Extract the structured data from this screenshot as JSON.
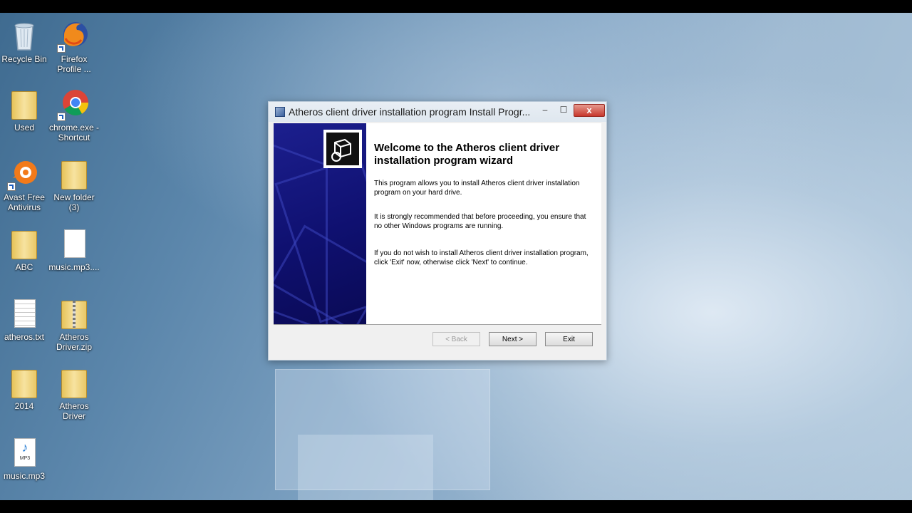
{
  "desktop": {
    "icons": [
      {
        "label": "Recycle Bin",
        "icon": "recycle-bin-icon"
      },
      {
        "label": "Firefox Profile ...",
        "icon": "firefox-icon"
      },
      {
        "label": "Used",
        "icon": "folder-icon"
      },
      {
        "label": "chrome.exe - Shortcut",
        "icon": "chrome-icon"
      },
      {
        "label": "Avast Free Antivirus",
        "icon": "avast-icon"
      },
      {
        "label": "New folder (3)",
        "icon": "folder-icon"
      },
      {
        "label": "ABC",
        "icon": "folder-icon"
      },
      {
        "label": "music.mp3....",
        "icon": "file-icon"
      },
      {
        "label": "atheros.txt",
        "icon": "text-file-icon"
      },
      {
        "label": "Atheros Driver.zip",
        "icon": "zip-folder-icon"
      },
      {
        "label": "2014",
        "icon": "folder-icon"
      },
      {
        "label": "Atheros Driver",
        "icon": "folder-icon"
      },
      {
        "label": "music.mp3",
        "icon": "mp3-icon"
      }
    ]
  },
  "dialog": {
    "title": "Atheros client driver installation program Install Progr...",
    "minimize": "–",
    "maximize": "☐",
    "close": "x",
    "heading": "Welcome to the Atheros client driver installation program wizard",
    "para1": "This program allows you to install Atheros client driver installation program on your hard drive.",
    "para2": "It is strongly recommended that before proceeding, you ensure that no other Windows programs are running.",
    "para3": "If you do not wish to install Atheros client driver installation program, click 'Exit' now, otherwise click 'Next' to continue.",
    "buttons": {
      "back": "< Back",
      "next": "Next >",
      "exit": "Exit"
    }
  },
  "colors": {
    "banner": "#10117a",
    "close_button": "#c7372c"
  }
}
